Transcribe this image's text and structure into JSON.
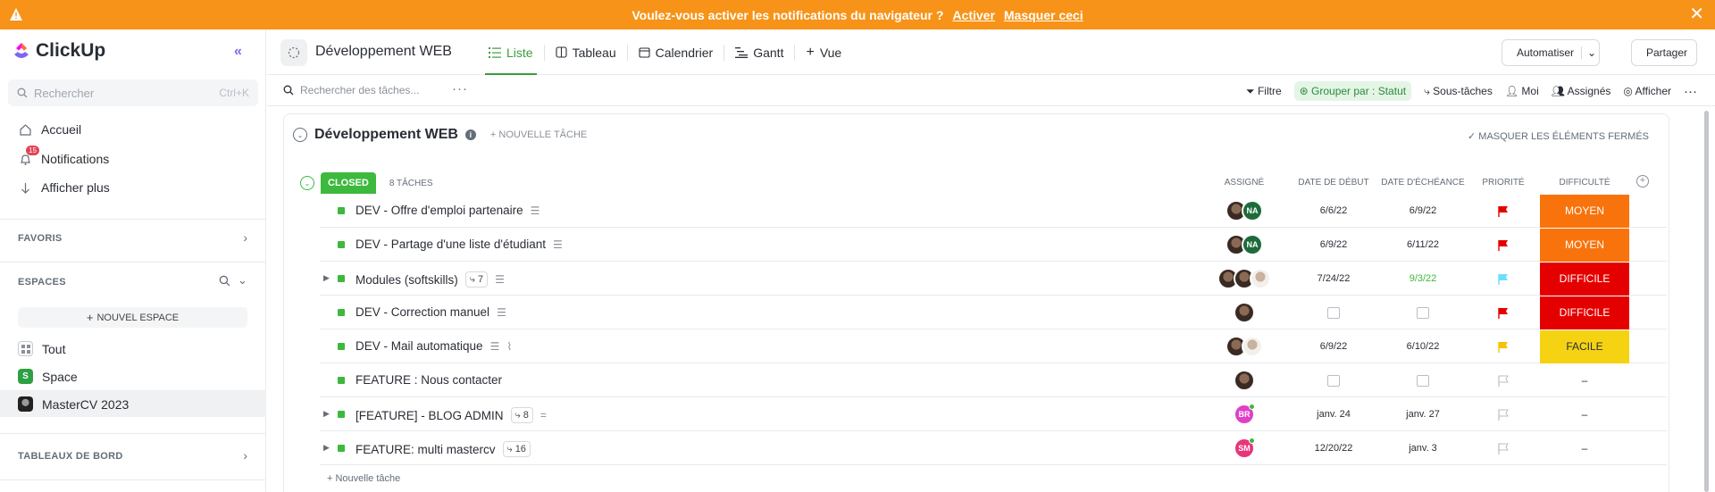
{
  "banner": {
    "message": "Voulez-vous activer les notifications du navigateur ?",
    "activate": "Activer",
    "hide": "Masquer ceci",
    "close": "✕",
    "bg_color": "#f79318"
  },
  "sidebar": {
    "logo": "ClickUp",
    "search_placeholder": "Rechercher",
    "search_shortcut": "Ctrl+K",
    "nav": [
      {
        "label": "Accueil",
        "icon": "home-icon"
      },
      {
        "label": "Notifications",
        "icon": "bell-icon",
        "badge": "15"
      },
      {
        "label": "Afficher plus",
        "icon": "arrow-down-icon"
      }
    ],
    "favorites": "FAVORIS",
    "spaces": "ESPACES",
    "new_space": "NOUVEL ESPACE",
    "space_items": [
      {
        "label": "Tout",
        "icon": "grid-icon"
      },
      {
        "label": "Space",
        "letter": "S",
        "color": "#2ea043"
      },
      {
        "label": "MasterCV 2023",
        "icon": "avatar-icon"
      }
    ],
    "dashboards": "TABLEAUX DE BORD"
  },
  "header": {
    "title": "Développement WEB",
    "views": [
      "Liste",
      "Tableau",
      "Calendrier",
      "Gantt"
    ],
    "add_view": "Vue",
    "automate": "Automatiser",
    "share": "Partager"
  },
  "toolbar": {
    "search_placeholder": "Rechercher des tâches...",
    "filter": "Filtre",
    "group_by": "Grouper par : Statut",
    "subtasks": "Sous-tâches",
    "me": "Moi",
    "assignees": "Assignés",
    "show": "Afficher"
  },
  "list": {
    "title": "Développement WEB",
    "new_task": "+ NOUVELLE TÂCHE",
    "hide_closed": "MASQUER LES ÉLÉMENTS FERMÉS",
    "group_status": "CLOSED",
    "group_count": "8 TÂCHES",
    "columns": {
      "assignee": "ASSIGNÉ",
      "start": "DATE DE DÉBUT",
      "due": "DATE D'ÉCHÉANCE",
      "priority": "PRIORITÉ",
      "difficulty": "DIFFICULTÉ"
    },
    "tasks": [
      {
        "name": "DEV - Offre d'emploi partenaire",
        "start": "6/6/22",
        "due": "6/9/22",
        "difficulty": "MOYEN",
        "priority": "urgent"
      },
      {
        "name": "DEV - Partage d'une liste d'étudiant",
        "start": "6/9/22",
        "due": "6/11/22",
        "difficulty": "MOYEN",
        "priority": "urgent"
      },
      {
        "name": "Modules (softskills)",
        "subtasks": "7",
        "start": "7/24/22",
        "due": "9/3/22",
        "difficulty": "DIFFICILE",
        "priority": "normal"
      },
      {
        "name": "DEV - Correction manuel",
        "start": "",
        "due": "",
        "difficulty": "DIFFICILE",
        "priority": "urgent"
      },
      {
        "name": "DEV - Mail automatique",
        "start": "6/9/22",
        "due": "6/10/22",
        "difficulty": "FACILE",
        "priority": "high"
      },
      {
        "name": "FEATURE : Nous contacter",
        "start": "",
        "due": "",
        "difficulty": "–",
        "priority": "none"
      },
      {
        "name": "[FEATURE] - BLOG ADMIN",
        "subtasks": "8",
        "start": "janv. 24",
        "due": "janv. 27",
        "difficulty": "–",
        "priority": "none"
      },
      {
        "name": "FEATURE: multi mastercv",
        "subtasks": "16",
        "start": "12/20/22",
        "due": "janv. 3",
        "difficulty": "–",
        "priority": "none"
      }
    ],
    "avatar_initials": {
      "na": "NA",
      "br": "BR",
      "sm": "SM"
    },
    "new_task_row": "+ Nouvelle tâche",
    "colors": {
      "moyen": "#f9730c",
      "difficile": "#e50000",
      "facile": "#f5d312",
      "closed": "#3db93d",
      "due_green": "#3db93d"
    }
  }
}
